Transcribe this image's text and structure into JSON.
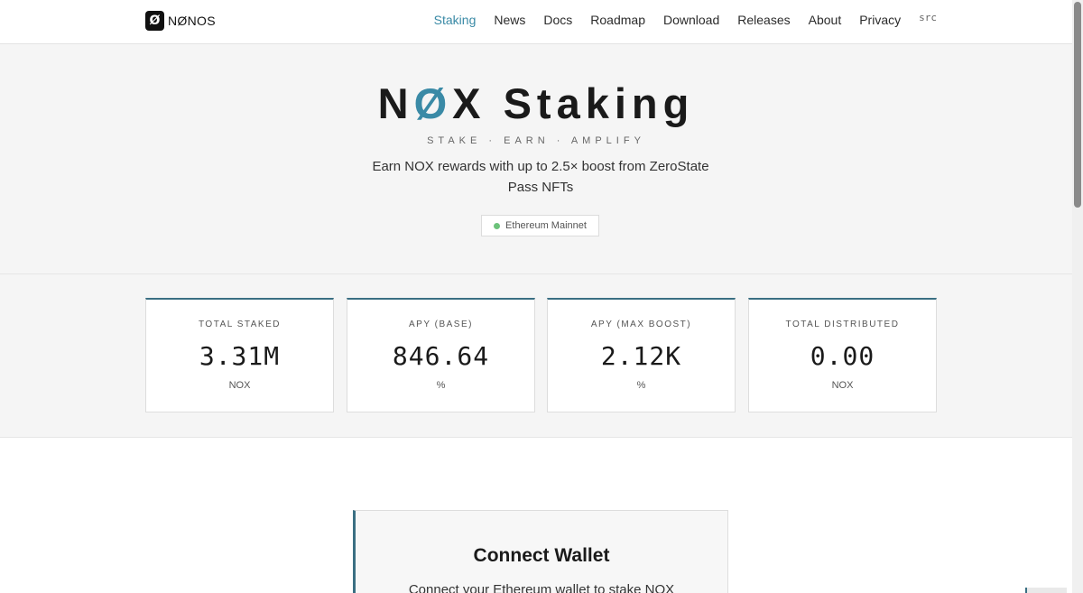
{
  "header": {
    "logo_text": "NØNOS",
    "logo_mark": "Ø",
    "nav": [
      {
        "label": "Staking",
        "active": true
      },
      {
        "label": "News"
      },
      {
        "label": "Docs"
      },
      {
        "label": "Roadmap"
      },
      {
        "label": "Download"
      },
      {
        "label": "Releases"
      },
      {
        "label": "About"
      },
      {
        "label": "Privacy"
      },
      {
        "label": "src"
      }
    ]
  },
  "hero": {
    "title_pre": "N",
    "title_slash": "Ø",
    "title_post": "X Staking",
    "subtitle": "STAKE · EARN · AMPLIFY",
    "description": "Earn NOX rewards with up to 2.5× boost from ZeroState Pass NFTs",
    "network_badge": "Ethereum Mainnet"
  },
  "stats": [
    {
      "label": "TOTAL STAKED",
      "value": "3.31M",
      "unit": "NOX"
    },
    {
      "label": "APY (BASE)",
      "value": "846.64",
      "unit": "%"
    },
    {
      "label": "APY (MAX BOOST)",
      "value": "2.12K",
      "unit": "%"
    },
    {
      "label": "TOTAL DISTRIBUTED",
      "value": "0.00",
      "unit": "NOX"
    }
  ],
  "wallet": {
    "title": "Connect Wallet",
    "description": "Connect your Ethereum wallet to stake NOX"
  },
  "colors": {
    "accent": "#3a8aa6",
    "card_border": "#3a6f83",
    "status_dot": "#6cc27a"
  }
}
